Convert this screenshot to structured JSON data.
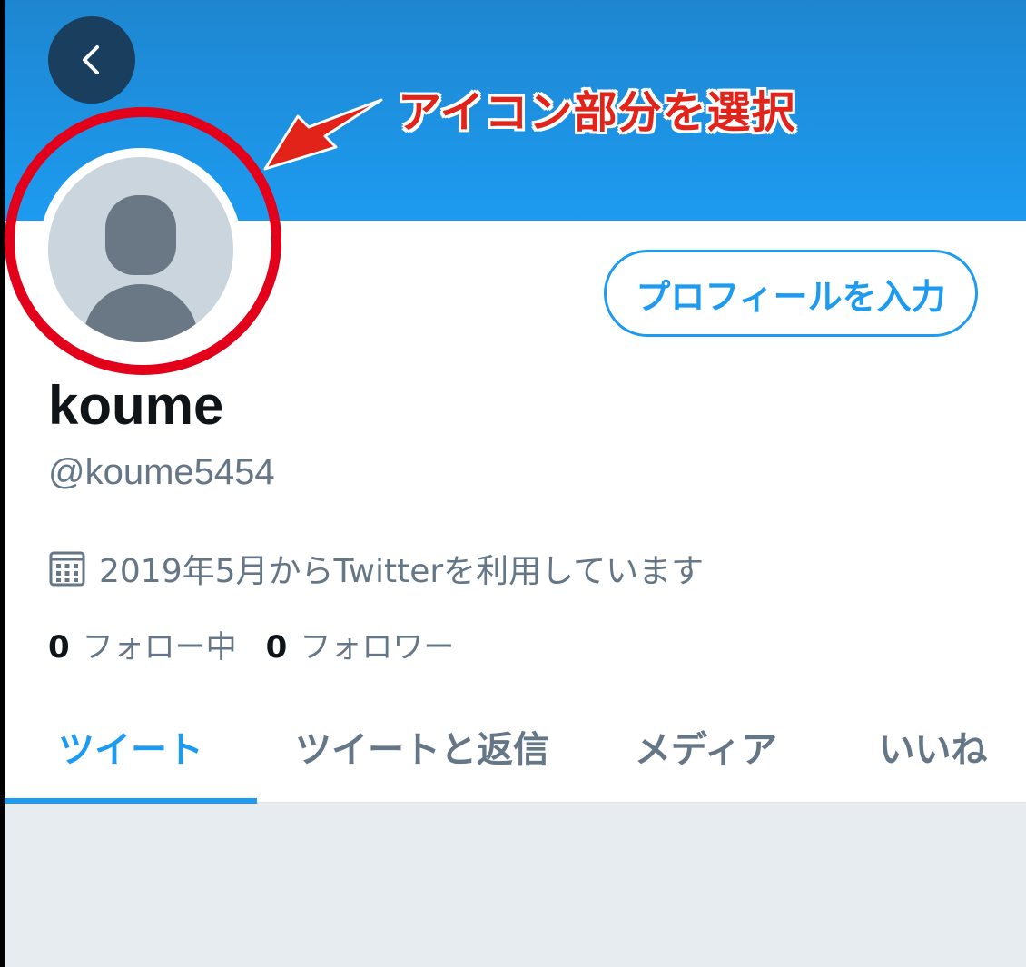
{
  "annotation": {
    "text": "アイコン部分を選択"
  },
  "profile": {
    "display_name": "koume",
    "handle": "@koume5454",
    "joined": "2019年5月からTwitterを利用しています",
    "edit_button_label": "プロフィールを入力"
  },
  "stats": {
    "following_count": "0",
    "following_label": "フォロー中",
    "followers_count": "0",
    "followers_label": "フォロワー"
  },
  "tabs": [
    {
      "label": "ツイート",
      "active": true
    },
    {
      "label": "ツイートと返信",
      "active": false
    },
    {
      "label": "メディア",
      "active": false
    },
    {
      "label": "いいね",
      "active": false
    }
  ],
  "colors": {
    "accent": "#1d9bf0",
    "annotation_red": "#e2231a",
    "secondary_text": "#657786"
  },
  "icons": [
    "back-arrow-icon",
    "calendar-icon",
    "default-avatar-icon",
    "annotation-arrow-icon"
  ]
}
